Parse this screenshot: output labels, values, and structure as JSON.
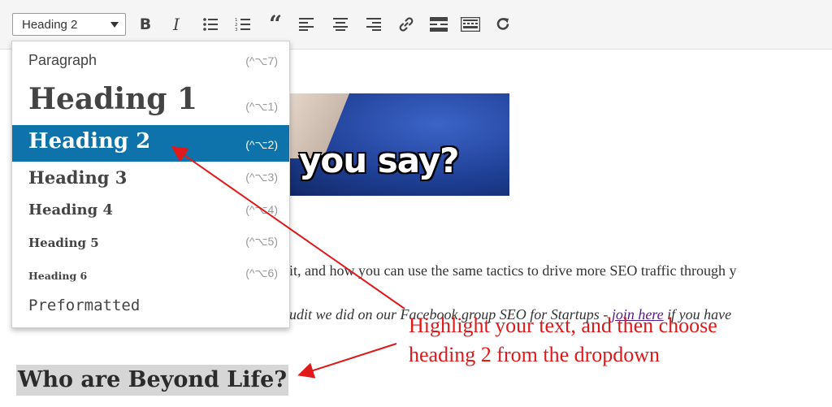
{
  "toolbar": {
    "format_select": {
      "value": "Heading 2"
    },
    "buttons": [
      {
        "name": "bold-button",
        "icon": "bold-icon"
      },
      {
        "name": "italic-button",
        "icon": "italic-icon"
      },
      {
        "name": "bulleted-list-button",
        "icon": "bulleted-list-icon"
      },
      {
        "name": "numbered-list-button",
        "icon": "numbered-list-icon"
      },
      {
        "name": "blockquote-button",
        "icon": "blockquote-icon"
      },
      {
        "name": "align-left-button",
        "icon": "align-left-icon"
      },
      {
        "name": "align-center-button",
        "icon": "align-center-icon"
      },
      {
        "name": "align-right-button",
        "icon": "align-right-icon"
      },
      {
        "name": "insert-link-button",
        "icon": "link-icon"
      },
      {
        "name": "read-more-button",
        "icon": "read-more-icon"
      },
      {
        "name": "toolbar-toggle-button",
        "icon": "keyboard-icon"
      },
      {
        "name": "refresh-button",
        "icon": "refresh-icon"
      }
    ]
  },
  "dropdown": {
    "options": [
      {
        "label": "Paragraph",
        "shortcut": "(^⌥7)"
      },
      {
        "label": "Heading 1",
        "shortcut": "(^⌥1)"
      },
      {
        "label": "Heading 2",
        "shortcut": "(^⌥2)",
        "selected": true
      },
      {
        "label": "Heading 3",
        "shortcut": "(^⌥3)"
      },
      {
        "label": "Heading 4",
        "shortcut": "(^⌥4)"
      },
      {
        "label": "Heading 5",
        "shortcut": "(^⌥5)"
      },
      {
        "label": "Heading 6",
        "shortcut": "(^⌥6)"
      },
      {
        "label": "Preformatted",
        "shortcut": ""
      }
    ]
  },
  "content": {
    "image_caption": "you say?",
    "paragraph1": "it, and how you can use the same tactics to drive more SEO traffic through y",
    "paragraph2_before": "udit we did on our Facebook group SEO for Startups - ",
    "paragraph2_link": "join here",
    "paragraph2_after": " if you have",
    "heading": "Who are Beyond Life?"
  },
  "annotation": {
    "line1": "Highlight your text, and then choose",
    "line2": "heading 2 from the dropdown",
    "color": "#e0191b"
  },
  "colors": {
    "selected_option": "#0e73aa",
    "text_highlight": "#d6d6d6",
    "link": "#551a8b"
  }
}
